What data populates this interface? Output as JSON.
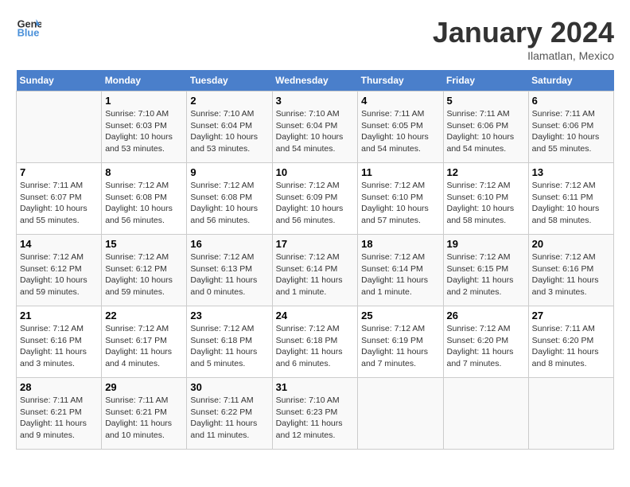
{
  "header": {
    "logo_line1": "General",
    "logo_line2": "Blue",
    "month_year": "January 2024",
    "location": "Ilamatlan, Mexico"
  },
  "weekdays": [
    "Sunday",
    "Monday",
    "Tuesday",
    "Wednesday",
    "Thursday",
    "Friday",
    "Saturday"
  ],
  "weeks": [
    [
      {
        "day": "",
        "empty": true
      },
      {
        "day": "1",
        "sunrise": "7:10 AM",
        "sunset": "6:03 PM",
        "daylight": "10 hours and 53 minutes."
      },
      {
        "day": "2",
        "sunrise": "7:10 AM",
        "sunset": "6:04 PM",
        "daylight": "10 hours and 53 minutes."
      },
      {
        "day": "3",
        "sunrise": "7:10 AM",
        "sunset": "6:04 PM",
        "daylight": "10 hours and 54 minutes."
      },
      {
        "day": "4",
        "sunrise": "7:11 AM",
        "sunset": "6:05 PM",
        "daylight": "10 hours and 54 minutes."
      },
      {
        "day": "5",
        "sunrise": "7:11 AM",
        "sunset": "6:06 PM",
        "daylight": "10 hours and 54 minutes."
      },
      {
        "day": "6",
        "sunrise": "7:11 AM",
        "sunset": "6:06 PM",
        "daylight": "10 hours and 55 minutes."
      }
    ],
    [
      {
        "day": "7",
        "sunrise": "7:11 AM",
        "sunset": "6:07 PM",
        "daylight": "10 hours and 55 minutes."
      },
      {
        "day": "8",
        "sunrise": "7:12 AM",
        "sunset": "6:08 PM",
        "daylight": "10 hours and 56 minutes."
      },
      {
        "day": "9",
        "sunrise": "7:12 AM",
        "sunset": "6:08 PM",
        "daylight": "10 hours and 56 minutes."
      },
      {
        "day": "10",
        "sunrise": "7:12 AM",
        "sunset": "6:09 PM",
        "daylight": "10 hours and 56 minutes."
      },
      {
        "day": "11",
        "sunrise": "7:12 AM",
        "sunset": "6:10 PM",
        "daylight": "10 hours and 57 minutes."
      },
      {
        "day": "12",
        "sunrise": "7:12 AM",
        "sunset": "6:10 PM",
        "daylight": "10 hours and 58 minutes."
      },
      {
        "day": "13",
        "sunrise": "7:12 AM",
        "sunset": "6:11 PM",
        "daylight": "10 hours and 58 minutes."
      }
    ],
    [
      {
        "day": "14",
        "sunrise": "7:12 AM",
        "sunset": "6:12 PM",
        "daylight": "10 hours and 59 minutes."
      },
      {
        "day": "15",
        "sunrise": "7:12 AM",
        "sunset": "6:12 PM",
        "daylight": "10 hours and 59 minutes."
      },
      {
        "day": "16",
        "sunrise": "7:12 AM",
        "sunset": "6:13 PM",
        "daylight": "11 hours and 0 minutes."
      },
      {
        "day": "17",
        "sunrise": "7:12 AM",
        "sunset": "6:14 PM",
        "daylight": "11 hours and 1 minute."
      },
      {
        "day": "18",
        "sunrise": "7:12 AM",
        "sunset": "6:14 PM",
        "daylight": "11 hours and 1 minute."
      },
      {
        "day": "19",
        "sunrise": "7:12 AM",
        "sunset": "6:15 PM",
        "daylight": "11 hours and 2 minutes."
      },
      {
        "day": "20",
        "sunrise": "7:12 AM",
        "sunset": "6:16 PM",
        "daylight": "11 hours and 3 minutes."
      }
    ],
    [
      {
        "day": "21",
        "sunrise": "7:12 AM",
        "sunset": "6:16 PM",
        "daylight": "11 hours and 3 minutes."
      },
      {
        "day": "22",
        "sunrise": "7:12 AM",
        "sunset": "6:17 PM",
        "daylight": "11 hours and 4 minutes."
      },
      {
        "day": "23",
        "sunrise": "7:12 AM",
        "sunset": "6:18 PM",
        "daylight": "11 hours and 5 minutes."
      },
      {
        "day": "24",
        "sunrise": "7:12 AM",
        "sunset": "6:18 PM",
        "daylight": "11 hours and 6 minutes."
      },
      {
        "day": "25",
        "sunrise": "7:12 AM",
        "sunset": "6:19 PM",
        "daylight": "11 hours and 7 minutes."
      },
      {
        "day": "26",
        "sunrise": "7:12 AM",
        "sunset": "6:20 PM",
        "daylight": "11 hours and 7 minutes."
      },
      {
        "day": "27",
        "sunrise": "7:11 AM",
        "sunset": "6:20 PM",
        "daylight": "11 hours and 8 minutes."
      }
    ],
    [
      {
        "day": "28",
        "sunrise": "7:11 AM",
        "sunset": "6:21 PM",
        "daylight": "11 hours and 9 minutes."
      },
      {
        "day": "29",
        "sunrise": "7:11 AM",
        "sunset": "6:21 PM",
        "daylight": "11 hours and 10 minutes."
      },
      {
        "day": "30",
        "sunrise": "7:11 AM",
        "sunset": "6:22 PM",
        "daylight": "11 hours and 11 minutes."
      },
      {
        "day": "31",
        "sunrise": "7:10 AM",
        "sunset": "6:23 PM",
        "daylight": "11 hours and 12 minutes."
      },
      {
        "day": "",
        "empty": true
      },
      {
        "day": "",
        "empty": true
      },
      {
        "day": "",
        "empty": true
      }
    ]
  ]
}
